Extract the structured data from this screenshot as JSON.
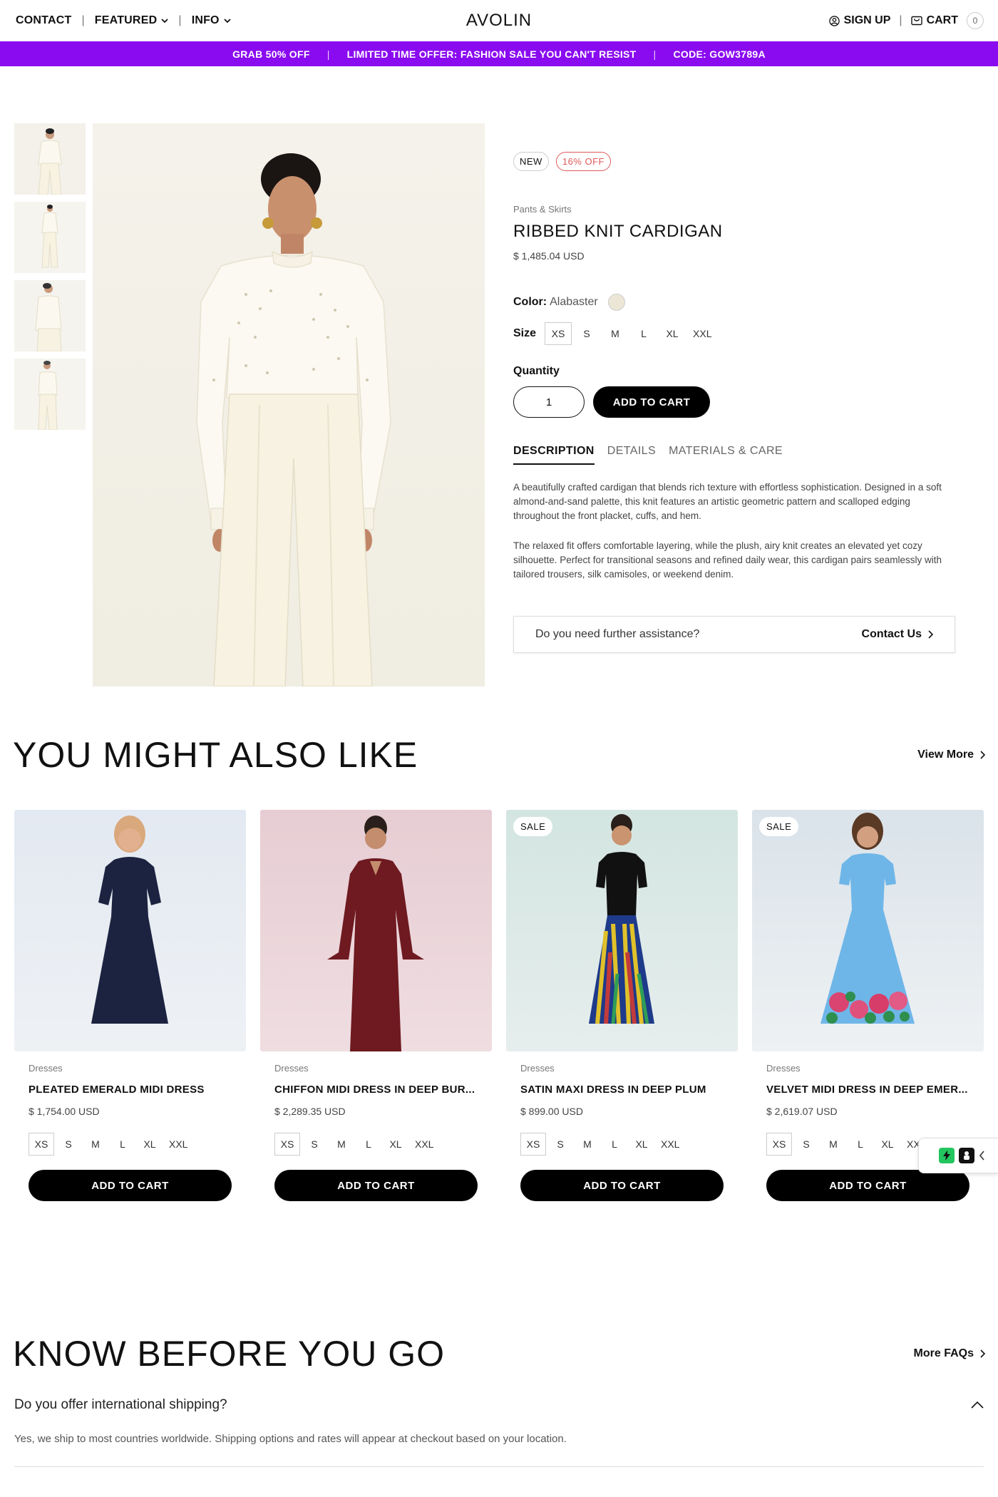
{
  "header": {
    "nav": {
      "contact": "CONTACT",
      "featured": "FEATURED",
      "info": "INFO",
      "separator": "|"
    },
    "logo": "AVOLIN",
    "sign_up": "SIGN UP",
    "cart": "CART",
    "cart_count": "0"
  },
  "promo": {
    "items": [
      "GRAB 50% OFF",
      "LIMITED TIME OFFER: FASHION SALE YOU CAN'T RESIST",
      "CODE: GOW3789A"
    ],
    "background": "#8a0bf0"
  },
  "product": {
    "badges": {
      "new": "NEW",
      "discount": "16% OFF"
    },
    "category": "Pants & Skirts",
    "title": "RIBBED KNIT CARDIGAN",
    "price": "$ 1,485.04 USD",
    "color_label": "Color:",
    "color_value": "Alabaster",
    "size_label": "Size",
    "sizes": [
      "XS",
      "S",
      "M",
      "L",
      "XL",
      "XXL"
    ],
    "selected_size": "XS",
    "quantity_label": "Quantity",
    "quantity": "1",
    "add_to_cart": "ADD TO CART",
    "tabs": [
      "DESCRIPTION",
      "DETAILS",
      "MATERIALS & CARE"
    ],
    "active_tab": "DESCRIPTION",
    "description": [
      "A beautifully crafted cardigan that blends rich texture with effortless sophistication. Designed in a soft almond-and-sand palette, this knit features an artistic geometric pattern and scalloped edging throughout the front placket, cuffs, and hem.",
      "The relaxed fit offers comfortable layering, while the plush, airy knit creates an elevated yet cozy silhouette. Perfect for transitional seasons and refined daily wear, this cardigan pairs seamlessly with tailored trousers, silk camisoles, or weekend denim."
    ],
    "assist_question": "Do you need further assistance?",
    "assist_link": "Contact Us"
  },
  "recommendations": {
    "title": "YOU MIGHT ALSO LIKE",
    "view_more": "View More",
    "sizes": [
      "XS",
      "S",
      "M",
      "L",
      "XL",
      "XXL"
    ],
    "add_to_cart": "ADD TO CART",
    "items": [
      {
        "category": "Dresses",
        "title": "PLEATED EMERALD MIDI DRESS",
        "price": "$ 1,754.00 USD",
        "sale": "",
        "dress_color": "#1c2340",
        "bg": "#e6ecf3"
      },
      {
        "category": "Dresses",
        "title": "CHIFFON MIDI DRESS IN DEEP BUR...",
        "price": "$ 2,289.35 USD",
        "sale": "",
        "dress_color": "#6e1a20",
        "bg": "#ecd3d8"
      },
      {
        "category": "Dresses",
        "title": "SATIN MAXI DRESS IN DEEP PLUM",
        "price": "$ 899.00 USD",
        "sale": "SALE",
        "dress_color": "#111111",
        "bg": "#d6e6e2"
      },
      {
        "category": "Dresses",
        "title": "VELVET MIDI DRESS IN DEEP EMER...",
        "price": "$ 2,619.07 USD",
        "sale": "SALE",
        "dress_color": "#6fb6e8",
        "bg": "#dfe7ec"
      }
    ]
  },
  "faq": {
    "title": "KNOW BEFORE YOU GO",
    "more": "More FAQs",
    "question": "Do you offer international shipping?",
    "answer": "Yes, we ship to most countries worldwide. Shipping options and rates will appear at checkout based on your location."
  }
}
